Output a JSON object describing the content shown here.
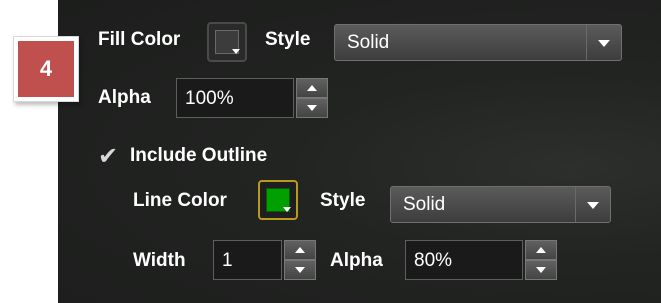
{
  "step_badge": {
    "number": "4",
    "color": "#c0504d"
  },
  "fill": {
    "color_label": "Fill Color",
    "color_value": "#3c3c3c",
    "style_label": "Style",
    "style_value": "Solid",
    "alpha_label": "Alpha",
    "alpha_value": "100%"
  },
  "outline": {
    "include_label": "Include Outline",
    "include_checked": true,
    "line_color_label": "Line Color",
    "line_color_value": "#00a000",
    "style_label": "Style",
    "style_value": "Solid",
    "width_label": "Width",
    "width_value": "1",
    "alpha_label": "Alpha",
    "alpha_value": "80%"
  },
  "icons": {
    "dropdown": "chevron-down-icon",
    "spin_up": "arrow-up-icon",
    "spin_down": "arrow-down-icon",
    "check": "checkmark-icon"
  }
}
